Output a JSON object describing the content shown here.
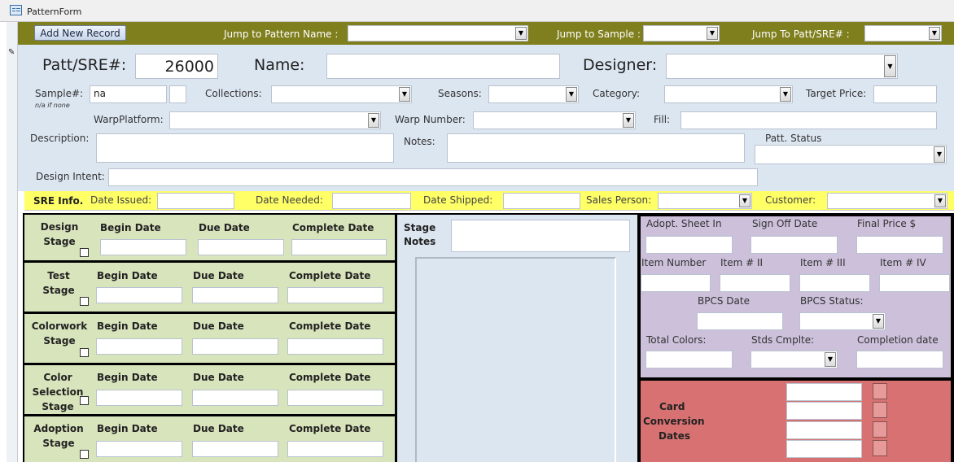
{
  "window": {
    "title": "PatternForm"
  },
  "top_bar": {
    "add_button": "Add New Record",
    "jump_pattern": "Jump to Pattern Name :",
    "jump_sample": "Jump to Sample :",
    "jump_patt": "Jump To Patt/SRE# :"
  },
  "header": {
    "patt_label": "Patt/SRE#:",
    "patt_value": "26000",
    "name_label": "Name:",
    "designer_label": "Designer:"
  },
  "row1": {
    "sample_label": "Sample#:",
    "sample_value": "na",
    "sample_hint": "n/a if none",
    "collections_label": "Collections:",
    "seasons_label": "Seasons:",
    "category_label": "Category:",
    "target_price_label": "Target Price:"
  },
  "row2": {
    "warp_platform_label": "WarpPlatform:",
    "warp_number_label": "Warp Number:",
    "fill_label": "Fill:"
  },
  "row3": {
    "description_label": "Description:",
    "notes_label": "Notes:",
    "patt_status_label": "Patt. Status"
  },
  "row4": {
    "design_intent_label": "Design Intent:"
  },
  "sre": {
    "title": "SRE Info.",
    "date_issued": "Date Issued:",
    "date_needed": "Date Needed:",
    "date_shipped": "Date Shipped:",
    "sales_person": "Sales Person:",
    "customer": "Customer:"
  },
  "stages": [
    {
      "name": "Design Stage",
      "begin": "Begin Date",
      "due": "Due Date",
      "complete": "Complete Date"
    },
    {
      "name": "Test Stage",
      "begin": "Begin Date",
      "due": "Due Date",
      "complete": "Complete Date"
    },
    {
      "name": "Colorwork Stage",
      "begin": "Begin Date",
      "due": "Due Date",
      "complete": "Complete Date"
    },
    {
      "name": "Color Selection Stage",
      "begin": "Begin Date",
      "due": "Due Date",
      "complete": "Complete Date"
    },
    {
      "name": "Adoption Stage",
      "begin": "Begin Date",
      "due": "Due Date",
      "complete": "Complete Date"
    }
  ],
  "stage_notes": {
    "label_line1": "Stage",
    "label_line2": "Notes"
  },
  "adoption": {
    "sheet_in": "Adopt. Sheet In",
    "sign_off": "Sign Off Date",
    "final_price": "Final Price $",
    "item_number": "Item Number",
    "item2": "Item # II",
    "item3": "Item # III",
    "item4": "Item # IV",
    "bpcs_date": "BPCS Date",
    "bpcs_status": "BPCS Status:",
    "total_colors": "Total Colors:",
    "stds_cmplte": "Stds Cmplte:",
    "completion_date": "Completion date"
  },
  "card": {
    "line1": "Card",
    "line2": "Conversion",
    "line3": "Dates"
  },
  "colors": {
    "olive": "#7f7f1e",
    "header_blue": "#dce6f1",
    "sre_yellow": "#ffff66",
    "stage_green": "#d8e4bc",
    "purple": "#ccc0da",
    "red": "#d87272"
  }
}
